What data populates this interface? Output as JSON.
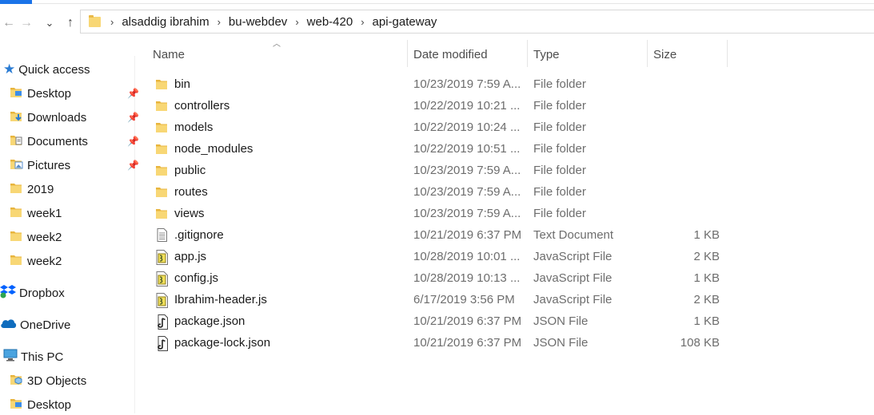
{
  "nav": {
    "back": "←",
    "forward": "→",
    "recent": "⌄",
    "up": "↑"
  },
  "breadcrumb": [
    "alsaddig ibrahim",
    "bu-webdev",
    "web-420",
    "api-gateway"
  ],
  "columns": {
    "name": "Name",
    "date": "Date modified",
    "type": "Type",
    "size": "Size"
  },
  "sidebar": {
    "quick_access": "Quick access",
    "items": [
      {
        "label": "Desktop",
        "icon": "desktop-folder-icon",
        "pinned": true
      },
      {
        "label": "Downloads",
        "icon": "downloads-folder-icon",
        "pinned": true
      },
      {
        "label": "Documents",
        "icon": "documents-folder-icon",
        "pinned": true
      },
      {
        "label": "Pictures",
        "icon": "pictures-folder-icon",
        "pinned": true
      },
      {
        "label": "2019",
        "icon": "folder-icon",
        "pinned": false
      },
      {
        "label": "week1",
        "icon": "folder-icon",
        "pinned": false
      },
      {
        "label": "week2",
        "icon": "folder-icon",
        "pinned": false
      },
      {
        "label": "week2",
        "icon": "folder-icon",
        "pinned": false
      }
    ],
    "dropbox": "Dropbox",
    "onedrive": "OneDrive",
    "this_pc": "This PC",
    "pc_items": [
      {
        "label": "3D Objects",
        "icon": "3d-objects-folder-icon"
      },
      {
        "label": "Desktop",
        "icon": "desktop-folder-icon"
      }
    ]
  },
  "files": [
    {
      "name": "bin",
      "date": "10/23/2019 7:59 A...",
      "type": "File folder",
      "size": "",
      "icon": "folder-icon"
    },
    {
      "name": "controllers",
      "date": "10/22/2019 10:21 ...",
      "type": "File folder",
      "size": "",
      "icon": "folder-icon"
    },
    {
      "name": "models",
      "date": "10/22/2019 10:24 ...",
      "type": "File folder",
      "size": "",
      "icon": "folder-icon"
    },
    {
      "name": "node_modules",
      "date": "10/22/2019 10:51 ...",
      "type": "File folder",
      "size": "",
      "icon": "folder-icon"
    },
    {
      "name": "public",
      "date": "10/23/2019 7:59 A...",
      "type": "File folder",
      "size": "",
      "icon": "folder-icon"
    },
    {
      "name": "routes",
      "date": "10/23/2019 7:59 A...",
      "type": "File folder",
      "size": "",
      "icon": "folder-icon"
    },
    {
      "name": "views",
      "date": "10/23/2019 7:59 A...",
      "type": "File folder",
      "size": "",
      "icon": "folder-icon"
    },
    {
      "name": ".gitignore",
      "date": "10/21/2019 6:37 PM",
      "type": "Text Document",
      "size": "1 KB",
      "icon": "text-file-icon"
    },
    {
      "name": "app.js",
      "date": "10/28/2019 10:01 ...",
      "type": "JavaScript File",
      "size": "2 KB",
      "icon": "js-file-icon"
    },
    {
      "name": "config.js",
      "date": "10/28/2019 10:13 ...",
      "type": "JavaScript File",
      "size": "1 KB",
      "icon": "js-file-icon"
    },
    {
      "name": "Ibrahim-header.js",
      "date": "6/17/2019 3:56 PM",
      "type": "JavaScript File",
      "size": "2 KB",
      "icon": "js-file-icon"
    },
    {
      "name": "package.json",
      "date": "10/21/2019 6:37 PM",
      "type": "JSON File",
      "size": "1 KB",
      "icon": "json-file-icon"
    },
    {
      "name": "package-lock.json",
      "date": "10/21/2019 6:37 PM",
      "type": "JSON File",
      "size": "108 KB",
      "icon": "json-file-icon"
    }
  ]
}
